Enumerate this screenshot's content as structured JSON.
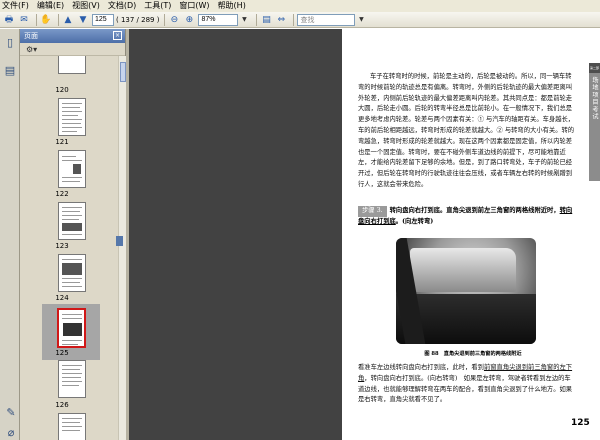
{
  "menu": [
    "文件(F)",
    "编辑(E)",
    "视图(V)",
    "文档(D)",
    "工具(T)",
    "窗口(W)",
    "帮助(H)"
  ],
  "toolbar": {
    "page_current": "125",
    "page_total": "( 137 / 289 )",
    "zoom": "87%",
    "search_placeholder": "查找"
  },
  "panel": {
    "title": "页面",
    "options_icon": "options-icon"
  },
  "thumbnails": [
    "120",
    "121",
    "122",
    "123",
    "124",
    "125",
    "126"
  ],
  "selected_page": "125",
  "document": {
    "paragraph1": "车子在转弯时的时候，前轮是主动的，后轮是被动的。所以，同一辆车转弯的时候前轮的轨迹总是有偏离。转弯时，外侧的后轮轨迹的最大偏差距离叫外轮差，内侧前后轮轨迹的最大偏差距离叫内轮差。其共同点是：都是前轮走大圆，后轮走小圆。后轮的转弯半径总是比前轮小。在一般情况下，我们总是更多地考虑内轮差。轮差与两个因素有关：① 与汽车的轴距有关。车身越长，车的前后轮相距越远，转弯时形成的轮差就越大。② 与转弯的大小有关。转的弯越急，转弯时形成的轮差就越大。现在这两个因素都是固定值，所以内轮差也是一个固定值。转弯时，要在不碰外侧车道边线的前提下，尽可能地靠近左，才能给内轮差留下足够的余地。但是，到了路口转弯处，车子的前轮已经开过，但后轮在转弯时的行驶轨迹往往会压线，或者车辆左右转的时候剐蹭到行人，这就会带来危险。",
    "step_label": "步骤 3.",
    "step_text": "转向盘向右打到底。直角尖退到前左三角窗的两格线附近时，转向盘向右打到底。(向左转弯)",
    "step_plain": "转向盘向右打到底。直角尖退到前左三角窗的两格线附近时，",
    "step_underlined": "转向盘向右打到底",
    "step_tail": "。(向左转弯)",
    "caption": "图 88　直角尖退到前三角窗的两格线附近",
    "paragraph2_a": "看准车左边线转向盘向右打到底，此时，看到",
    "paragraph2_ul": "前窗直角尖退到前三角窗的左下角",
    "paragraph2_b": "，转向盘向右打到底。(向右转弯)　如果是左转弯，驾驶者转看到左边的车道边线，也就能够理解转弯在两车的配合，看到直角尖退到了什么地方。如果是右转弯，直角尖就看不见了。",
    "page_number": "125",
    "side_tab_top": "第二部分",
    "side_tab_text": "场地项目考试"
  }
}
